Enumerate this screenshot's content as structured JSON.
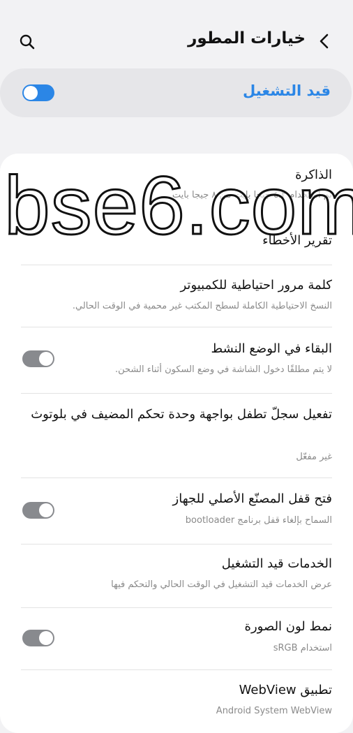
{
  "header": {
    "title": "خيارات المطور",
    "back_icon": "chevron-left-icon",
    "search_icon": "search-icon"
  },
  "master_switch": {
    "label": "قيد التشغيل",
    "state": "on"
  },
  "items": [
    {
      "title": "الذاكرة",
      "subtitle": "تم استخدام ٤.٣ جيجا بايت من ٨ جيجا بايت"
    },
    {
      "title": "تقرير الأخطاء"
    },
    {
      "title": "كلمة مرور احتياطية للكمبيوتر",
      "subtitle": "النسخ الاحتياطية الكاملة لسطح المكتب غير محمية في الوقت الحالي."
    },
    {
      "title": "البقاء في الوضع النشط",
      "subtitle": "لا يتم مطلقًا دخول الشاشة في وضع السكون أثناء الشحن.",
      "toggle": "off"
    },
    {
      "title": "تفعيل سجلّ تطفل بواجهة وحدة تحكم المضيف في بلوتوث",
      "subtitle": "غير مفعّل"
    },
    {
      "title": "فتح قفل المصنّع الأصلي للجهاز",
      "subtitle": "السماح بإلغاء قفل برنامج bootloader",
      "toggle": "off"
    },
    {
      "title": "الخدمات قيد التشغيل",
      "subtitle": "عرض الخدمات قيد التشغيل في الوقت الحالي والتحكم فيها"
    },
    {
      "title": "نمط لون الصورة",
      "subtitle": "استخدام sRGB",
      "toggle": "off"
    },
    {
      "title": "تطبيق WebView",
      "subtitle": "Android System WebView"
    }
  ],
  "watermark": {
    "text": "bse6.com"
  },
  "colors": {
    "accent": "#2b86e6",
    "background": "#f2f2f4",
    "card": "#ffffff",
    "toggle_off": "#888a8e"
  }
}
